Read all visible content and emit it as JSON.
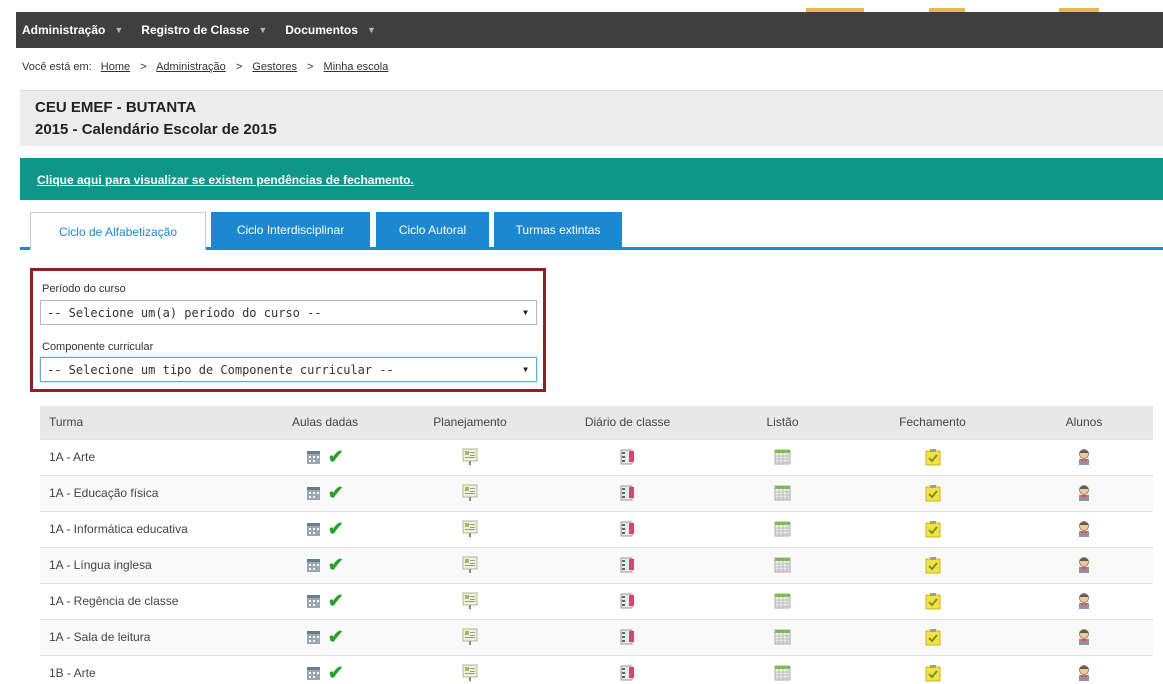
{
  "topnav": [
    {
      "label": "Administração"
    },
    {
      "label": "Registro de Classe"
    },
    {
      "label": "Documentos"
    }
  ],
  "breadcrumb": {
    "prefix": "Você está em:",
    "items": [
      "Home",
      "Administração",
      "Gestores",
      "Minha escola"
    ]
  },
  "header": {
    "school": "CEU EMEF - BUTANTA",
    "calendar": "2015 - Calendário Escolar de 2015"
  },
  "alert": {
    "link_text": "Clique aqui para visualizar se existem pendências de fechamento."
  },
  "tabs": [
    {
      "label": "Ciclo de Alfabetização",
      "active": true
    },
    {
      "label": "Ciclo Interdisciplinar",
      "active": false
    },
    {
      "label": "Ciclo Autoral",
      "active": false
    },
    {
      "label": "Turmas extintas",
      "active": false
    }
  ],
  "filters": {
    "periodo_label": "Período do curso",
    "periodo_value": "-- Selecione um(a) período do curso --",
    "componente_label": "Componente curricular",
    "componente_value": "-- Selecione um tipo de Componente curricular --"
  },
  "table": {
    "columns": [
      "Turma",
      "Aulas dadas",
      "Planejamento",
      "Diário de classe",
      "Listão",
      "Fechamento",
      "Alunos"
    ],
    "rows": [
      {
        "turma": "1A - Arte"
      },
      {
        "turma": "1A - Educação física"
      },
      {
        "turma": "1A - Informática educativa"
      },
      {
        "turma": "1A - Língua inglesa"
      },
      {
        "turma": "1A - Regência de classe"
      },
      {
        "turma": "1A - Sala de leitura"
      },
      {
        "turma": "1B - Arte"
      }
    ]
  },
  "icons": {
    "aulas_dadas": "calendar-icon",
    "aulas_dadas_status": "checkmark-icon",
    "planejamento": "planning-board-icon",
    "diario": "class-diary-icon",
    "listao": "spreadsheet-icon",
    "fechamento": "closing-checklist-icon",
    "alunos": "student-icon"
  },
  "colors": {
    "topbar": "#3f3f3f",
    "accent": "#e8b84a",
    "alert_bg": "#0e968a",
    "tab_blue": "#1b88d0",
    "filter_border": "#8b2323",
    "check_green": "#2e9e2e"
  }
}
